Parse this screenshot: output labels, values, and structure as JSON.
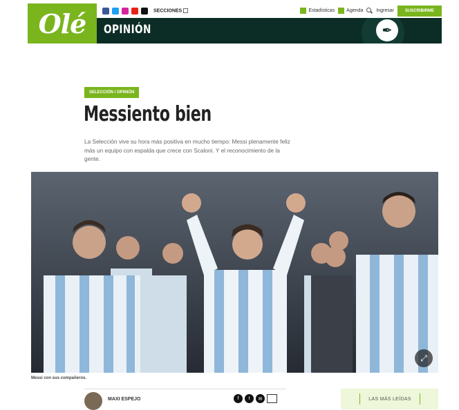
{
  "brand": {
    "logo_text": "Olé",
    "accent": "#7ab51d",
    "dark": "#0c2d26"
  },
  "topbar": {
    "social_icons": [
      "facebook-icon",
      "twitter-icon",
      "instagram-icon",
      "youtube-icon",
      "tiktok-icon"
    ],
    "secciones_label": "SECCIONES",
    "estadisticas_label": "Estadísticas",
    "agenda_label": "Agenda",
    "ingresar_label": "Ingresar",
    "subscribe_label": "SUSCRIBIRME"
  },
  "section": {
    "title": "OPINIÓN"
  },
  "article": {
    "tag": "SELECCIÓN / OPINIÓN",
    "headline": "Messiento bien",
    "dek": "La Selección vive su hora más positiva en mucho tiempo: Messi plenamente feliz más un equipo con espalda que crece con Scaloni. Y el reconocimiento de la gente.",
    "caption": "Messi con sus compañeros.",
    "author": "MAXI ESPEJO"
  },
  "sidebar": {
    "mas_leidas": "LAS MÁS LEÍDAS"
  }
}
